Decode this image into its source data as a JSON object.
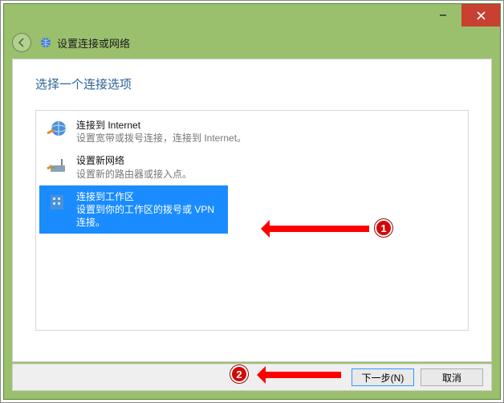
{
  "window": {
    "title": "设置连接或网络"
  },
  "heading": "选择一个连接选项",
  "options": [
    {
      "title": "连接到 Internet",
      "desc": "设置宽带或拨号连接，连接到 Internet。",
      "selected": false
    },
    {
      "title": "设置新网络",
      "desc": "设置新的路由器或接入点。",
      "selected": false
    },
    {
      "title": "连接到工作区",
      "desc": "设置到你的工作区的拨号或 VPN 连接。",
      "selected": true
    }
  ],
  "buttons": {
    "next": "下一步(N)",
    "cancel": "取消"
  },
  "annotations": {
    "b1": "1",
    "b2": "2"
  }
}
